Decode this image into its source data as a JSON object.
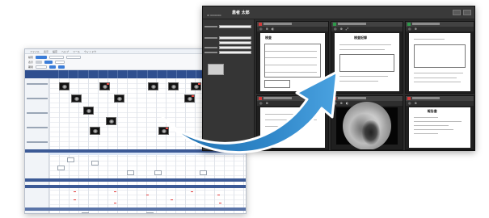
{
  "left_window": {
    "menu_items": [
      "ファイル",
      "表示",
      "設定",
      "ヘルプ",
      "ツール",
      "ウィンドウ"
    ],
    "toolbar_labels": [
      "検索",
      "表示",
      "期間",
      "患者"
    ],
    "accent_color": "#2f4f8f"
  },
  "right_window": {
    "patient_name": "患者 太郎",
    "sub_text": "ID 0000000",
    "pane_tool_glyphs": [
      "◎",
      "⊕",
      "◐",
      "⤢"
    ],
    "document_titles": [
      "検査",
      "検査記録",
      "報告書"
    ],
    "pane_accent_colors": [
      "#d23a3a",
      "#2d9a4a",
      "#2d9a4a",
      "#d23a3a",
      "#d23a3a",
      "#d23a3a"
    ]
  },
  "arrow": {
    "color": "#2f86c8",
    "icon": "curved-arrow-icon"
  }
}
